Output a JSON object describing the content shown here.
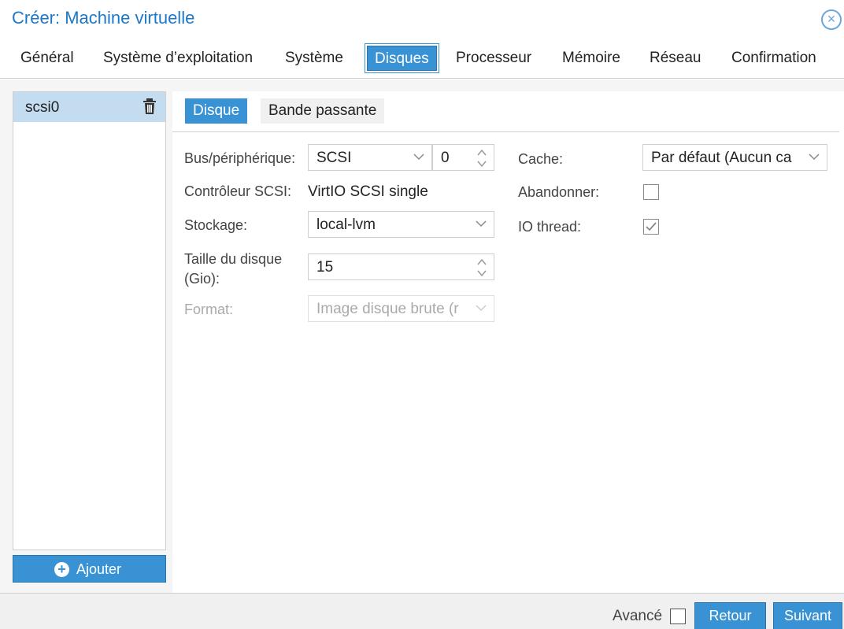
{
  "window": {
    "title": "Créer: Machine virtuelle"
  },
  "tabs": [
    {
      "label": "Général"
    },
    {
      "label": "Système d’exploitation"
    },
    {
      "label": "Système"
    },
    {
      "label": "Disques"
    },
    {
      "label": "Processeur"
    },
    {
      "label": "Mémoire"
    },
    {
      "label": "Réseau"
    },
    {
      "label": "Confirmation"
    }
  ],
  "active_tab": "Disques",
  "disks": {
    "items": [
      {
        "label": "scsi0",
        "selected": true
      }
    ],
    "add_label": "Ajouter"
  },
  "subtabs": [
    {
      "label": "Disque"
    },
    {
      "label": "Bande passante"
    }
  ],
  "form": {
    "bus_label": "Bus/périphérique:",
    "bus_value": "SCSI",
    "bus_index": "0",
    "controller_label": "Contrôleur SCSI:",
    "controller_value": "VirtIO SCSI single",
    "storage_label": "Stockage:",
    "storage_value": "local-lvm",
    "size_label_1": "Taille du disque",
    "size_label_2": "(Gio):",
    "size_value": "15",
    "format_label": "Format:",
    "format_value": "Image disque brute (r",
    "cache_label": "Cache:",
    "cache_value": "Par défaut (Aucun ca",
    "discard_label": "Abandonner:",
    "discard_checked": false,
    "iothread_label": "IO thread:",
    "iothread_checked": true
  },
  "footer": {
    "advanced_label": "Avancé",
    "advanced_checked": false,
    "back_label": "Retour",
    "next_label": "Suivant"
  },
  "colors": {
    "accent": "#3892d4",
    "title": "#1e78c8",
    "selected_row": "#c4dcf0"
  }
}
